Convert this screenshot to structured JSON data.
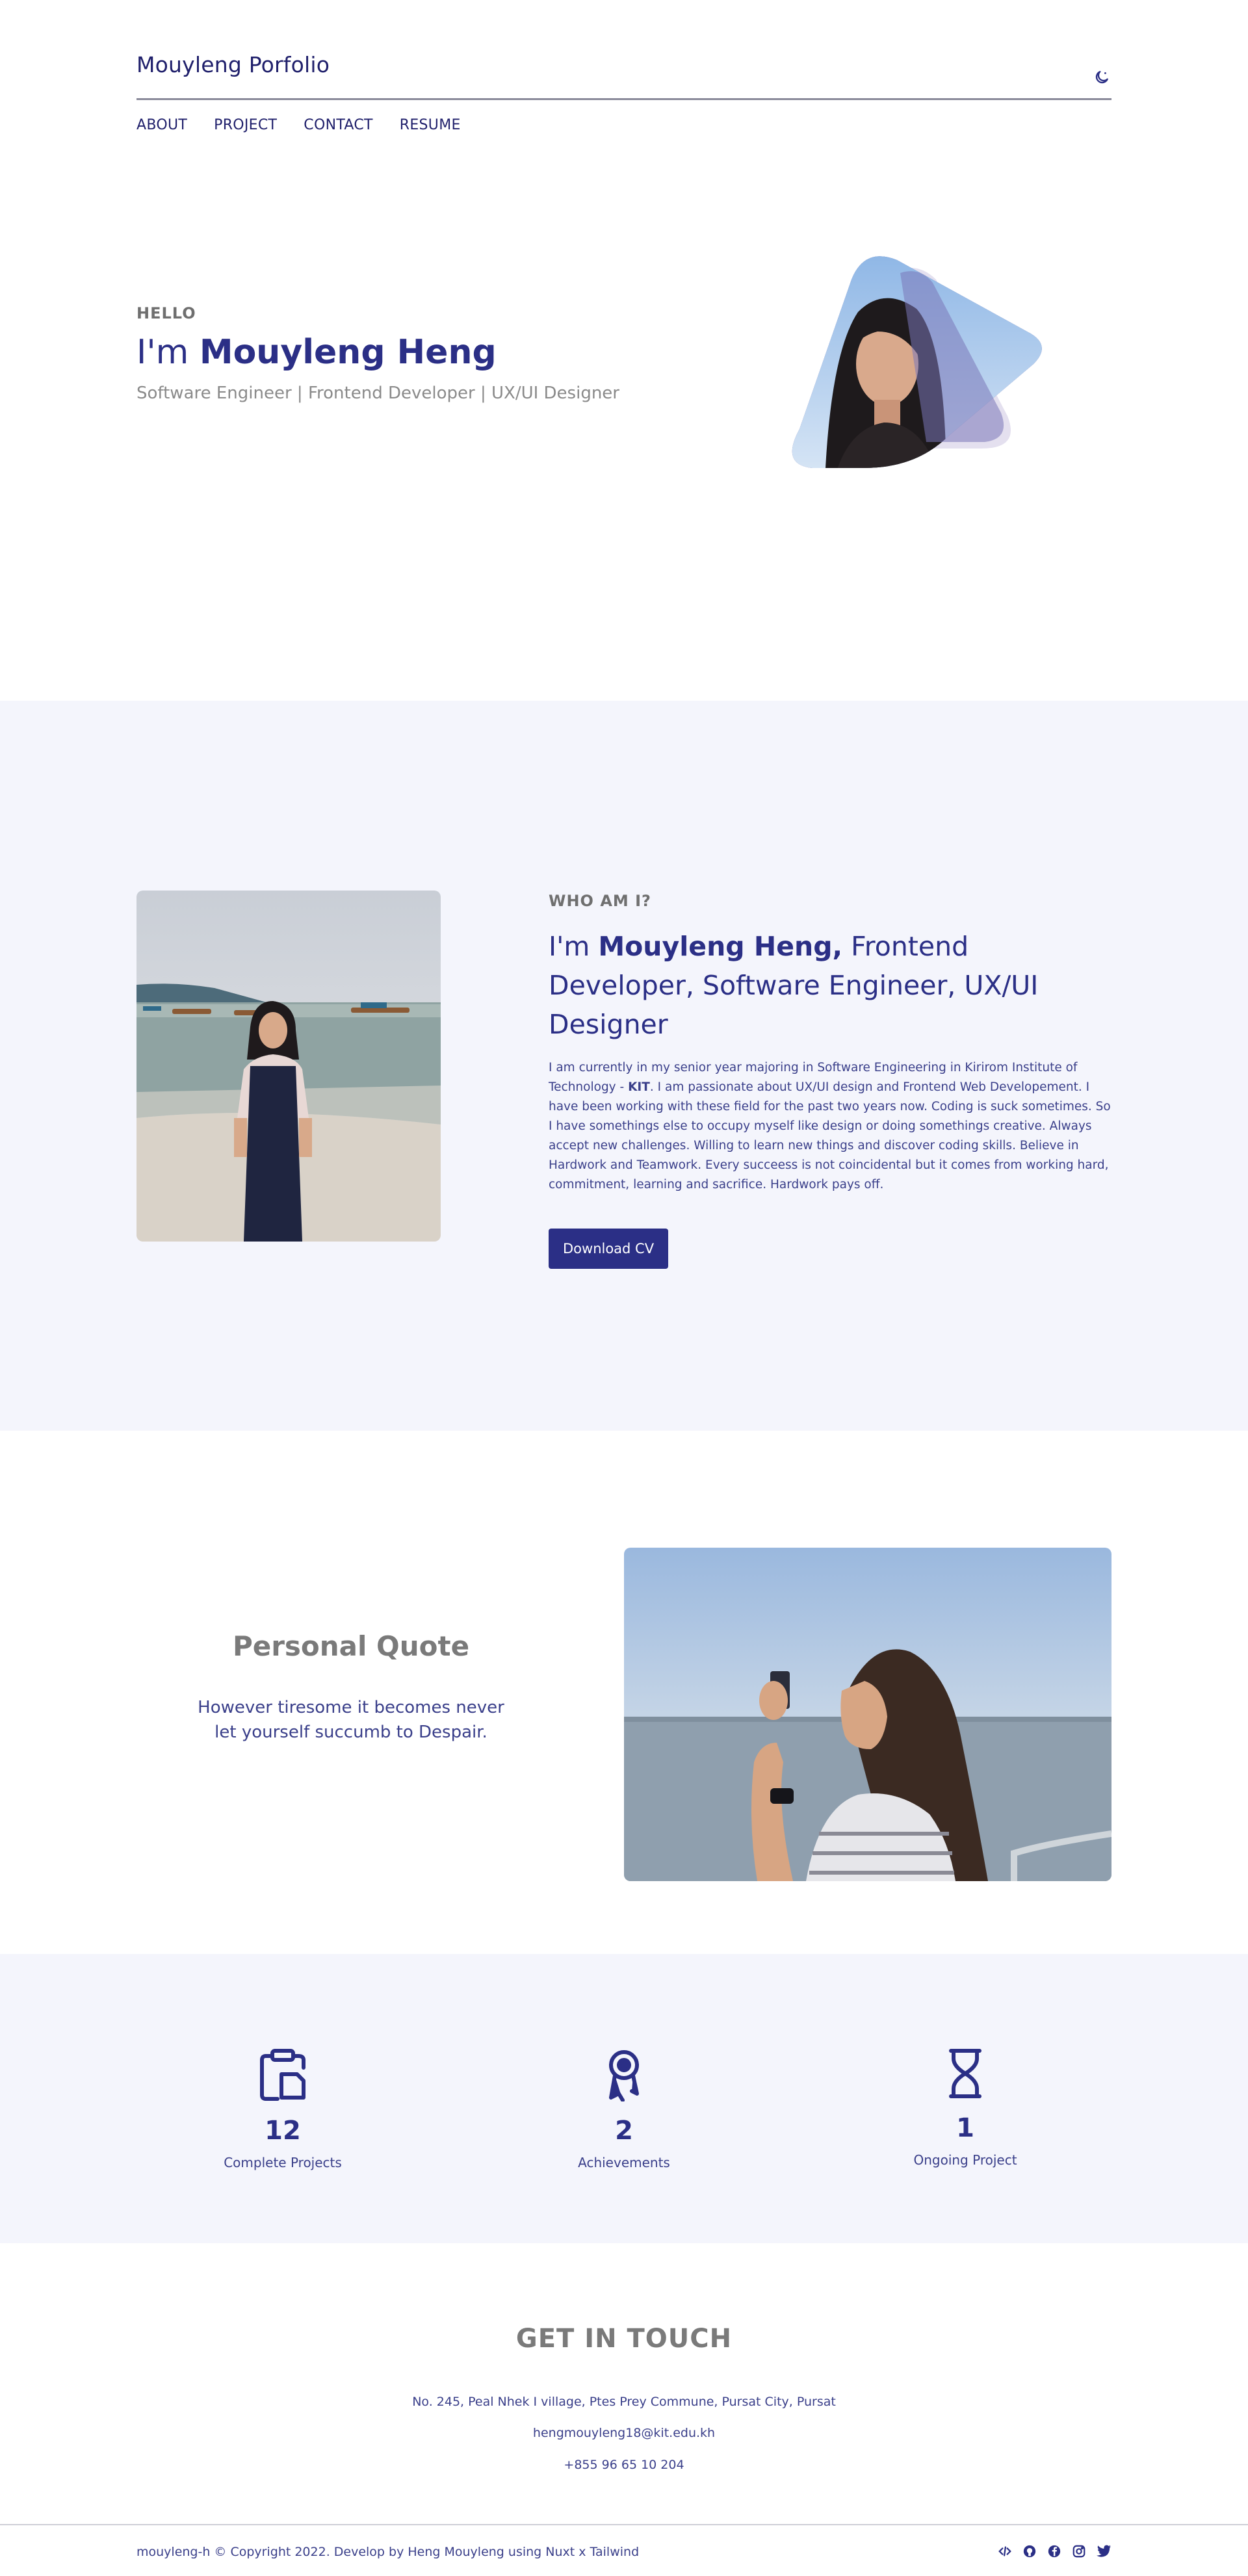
{
  "header": {
    "brand": "Mouyleng Porfolio",
    "nav": [
      "ABOUT",
      "PROJECT",
      "CONTACT",
      "RESUME"
    ]
  },
  "hero": {
    "greeting": "HELLO",
    "title_prefix": "I'm ",
    "name": "Mouyleng Heng",
    "subtitle": "Software Engineer | Frontend Developer | UX/UI Designer"
  },
  "about": {
    "label": "WHO AM I?",
    "title_prefix": "I'm ",
    "name": "Mouyleng Heng,",
    "title_suffix": " Frontend Developer, Software Engineer, UX/UI Designer",
    "body_part1": "I am currently in my senior year majoring in Software Engineering in Kirirom Institute of Technology - ",
    "body_bold": "KIT",
    "body_part2": ". I am passionate about UX/UI design and Frontend Web Developement. I have been working with these field for the past two years now. Coding is suck sometimes. So I have somethings else to occupy myself like design or doing somethings creative. Always accept new challenges. Willing to learn new things and discover coding skills. Believe in Hardwork and Teamwork. Every succeess is not coincidental but it comes from working hard, commitment, learning and sacrifice. Hardwork pays off.",
    "button": "Download CV"
  },
  "quote": {
    "title": "Personal Quote",
    "text": "However tiresome it becomes never let yourself succumb to Despair."
  },
  "stats": [
    {
      "icon": "clipboard-icon",
      "number": "12",
      "label": "Complete Projects"
    },
    {
      "icon": "award-icon",
      "number": "2",
      "label": "Achievements"
    },
    {
      "icon": "hourglass-icon",
      "number": "1",
      "label": "Ongoing Project"
    }
  ],
  "contact": {
    "title": "GET IN TOUCH",
    "address": "No. 245, Peal Nhek I village, Ptes Prey Commune, Pursat City, Pursat",
    "email": "hengmouyleng18@kit.edu.kh",
    "phone": "+855 96 65 10 204"
  },
  "footer": {
    "copyright": "mouyleng-h © Copyright 2022. Develop by Heng Mouyleng using Nuxt x Tailwind",
    "socials": [
      "code-icon",
      "github-icon",
      "facebook-icon",
      "instagram-icon",
      "twitter-icon"
    ]
  },
  "colors": {
    "primary": "#2b2f86",
    "accent": "#4a4a9c",
    "section_bg": "#f4f5fc",
    "muted": "#7a7a7a"
  }
}
